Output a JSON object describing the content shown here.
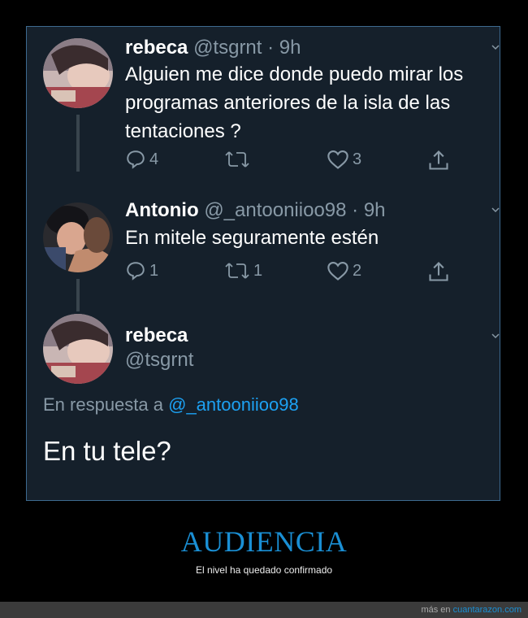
{
  "tweets": [
    {
      "display_name": "rebeca",
      "handle": "@tsgrnt",
      "time": "· 9h",
      "text": "Alguien me dice donde puedo mirar los programas anteriores de la isla de las tentaciones ?",
      "counts": {
        "replies": "4",
        "retweets": "",
        "likes": "3"
      }
    },
    {
      "display_name": "Antonio",
      "handle": "@_antooniioo98",
      "time": "· 9h",
      "text": "En mitele seguramente estén",
      "counts": {
        "replies": "1",
        "retweets": "1",
        "likes": "2"
      }
    }
  ],
  "focused_tweet": {
    "display_name": "rebeca",
    "handle": "@tsgrnt",
    "reply_prefix": "En respuesta a",
    "reply_mention": "@_antooniioo98",
    "text": "En tu tele?"
  },
  "caption": {
    "title": "AUDIENCIA",
    "subtitle": "El nivel ha quedado confirmado"
  },
  "footer": {
    "prefix": "más en",
    "site": "cuantarazon.com"
  },
  "icons": [
    "reply-icon",
    "retweet-icon",
    "like-icon",
    "share-icon",
    "chevron-down-icon"
  ],
  "colors": {
    "background": "#15202b",
    "secondary_text": "#8899a6",
    "link": "#1da1f2",
    "caption_accent": "#1a8fd4"
  }
}
